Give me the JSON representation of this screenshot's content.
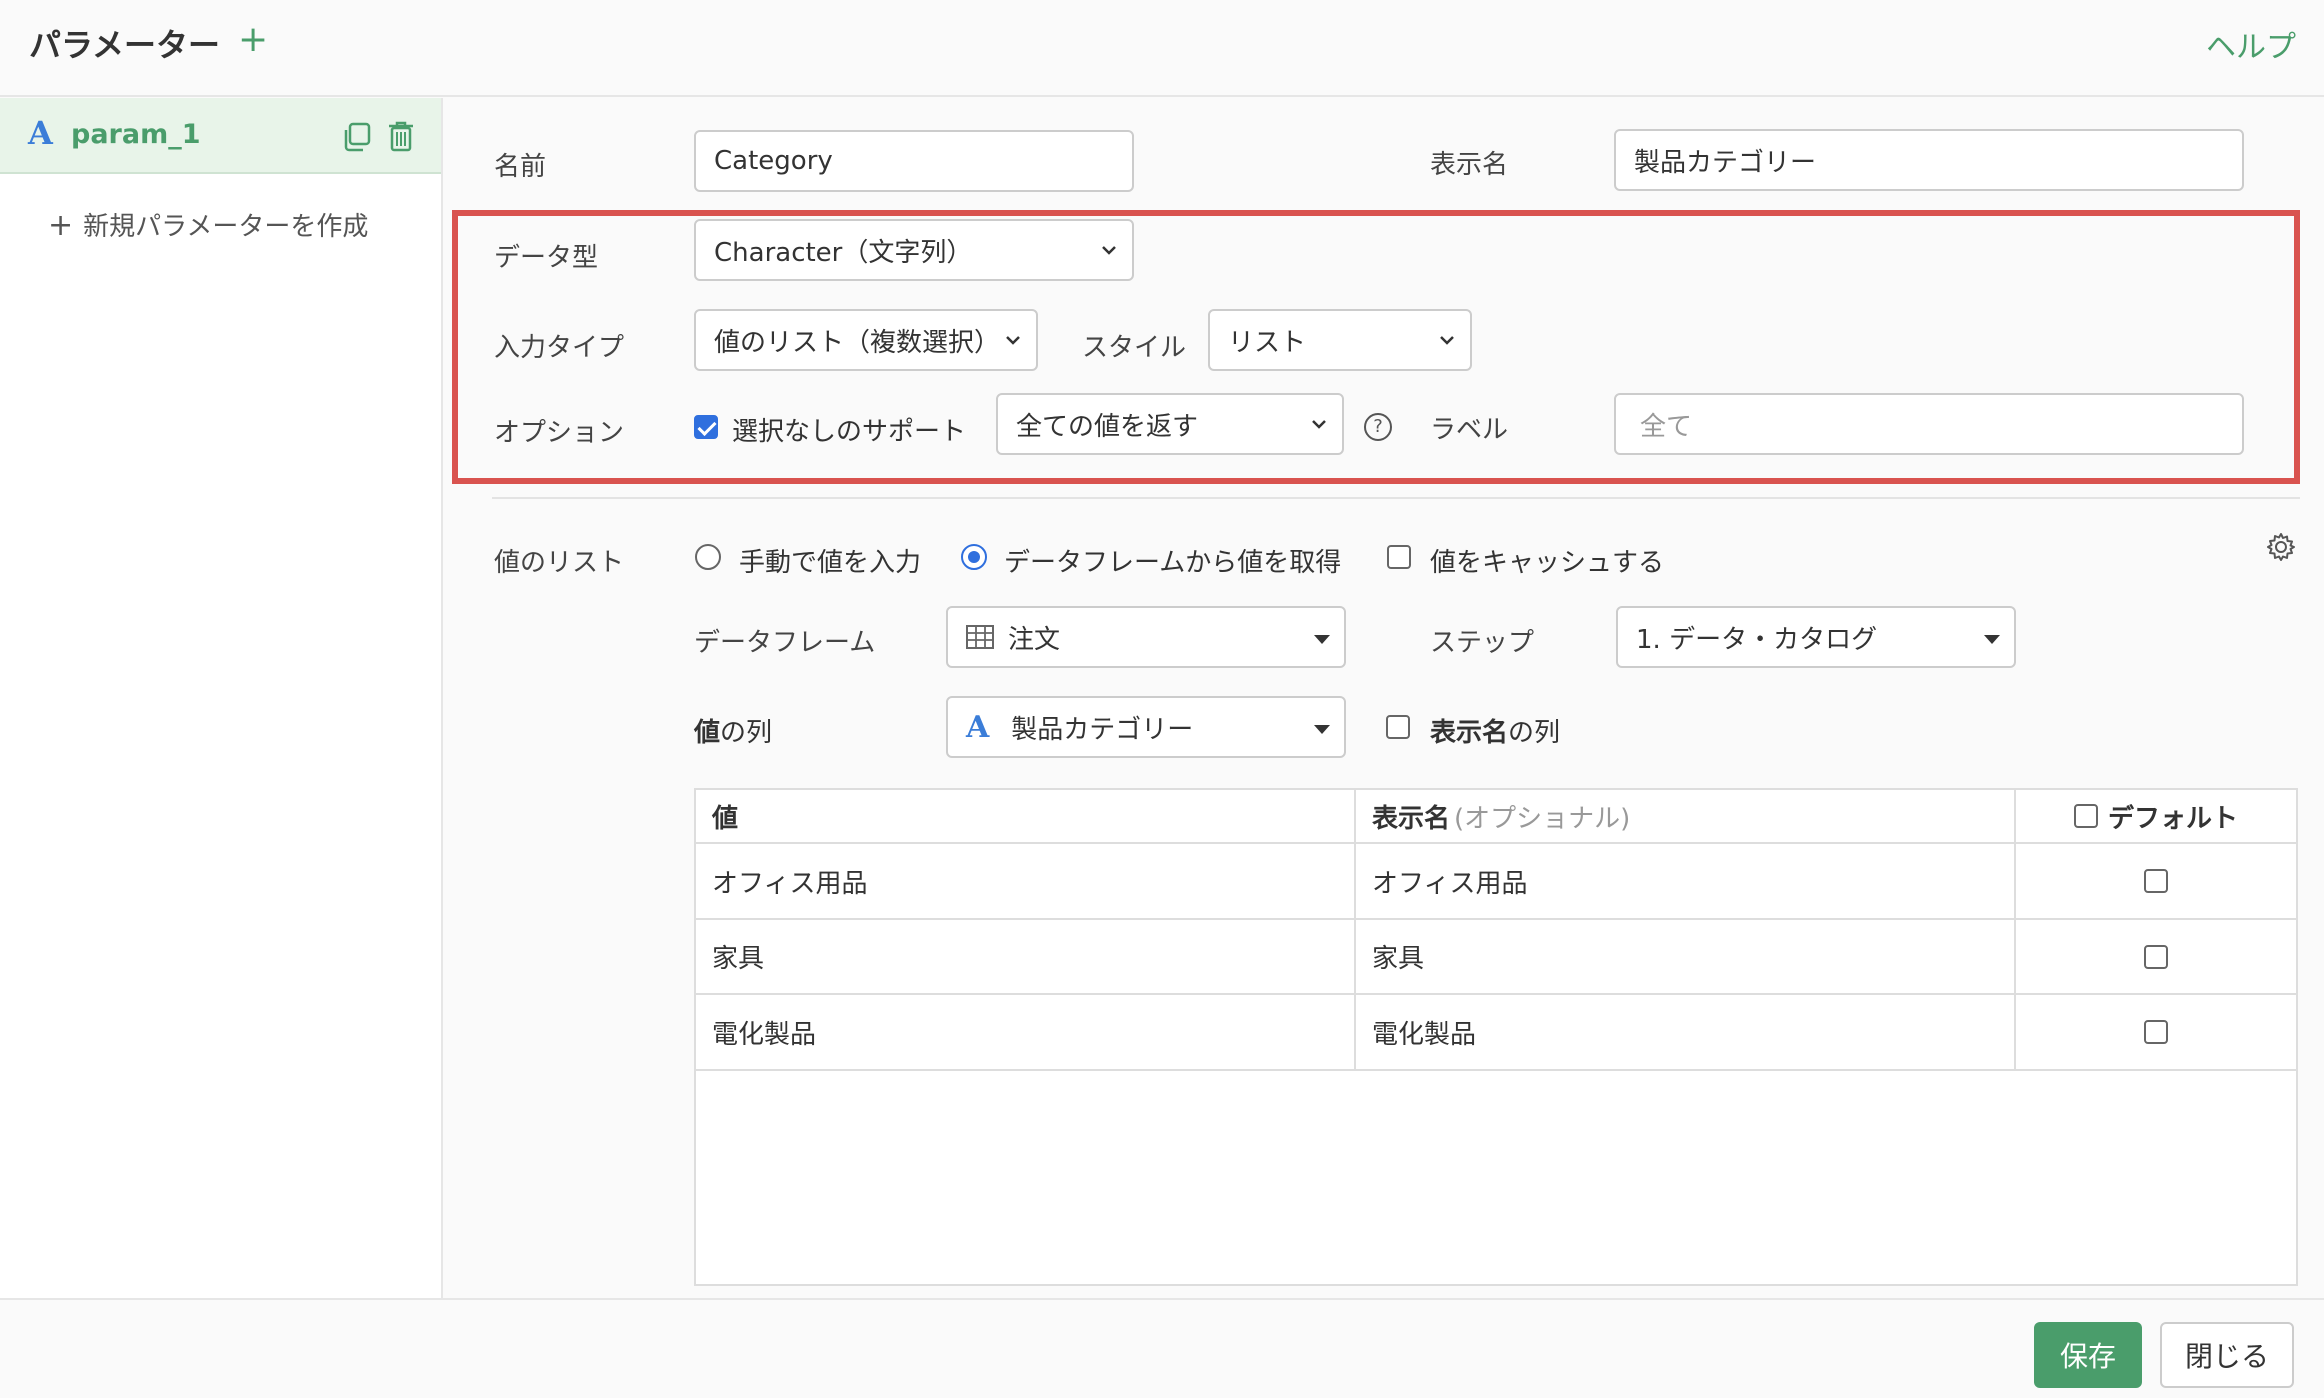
{
  "header": {
    "title": "パラメーター",
    "add_icon": "plus-icon",
    "help": "ヘルプ"
  },
  "sidebar": {
    "param": {
      "type_icon": "A",
      "name": "param_1"
    },
    "new_param": "新規パラメーターを作成"
  },
  "form": {
    "name_label": "名前",
    "name_value": "Category",
    "display_name_label": "表示名",
    "display_name_value": "製品カテゴリー",
    "data_type_label": "データ型",
    "data_type_value": "Character（文字列）",
    "input_type_label": "入力タイプ",
    "input_type_value": "値のリスト（複数選択）",
    "style_label": "スタイル",
    "style_value": "リスト",
    "option_label": "オプション",
    "no_selection_label": "選択なしのサポート",
    "no_selection_checked": true,
    "return_value": "全ての値を返す",
    "help_symbol": "?",
    "label_label": "ラベル",
    "label_value": "全て"
  },
  "values": {
    "section_label": "値のリスト",
    "manual_label": "手動で値を入力",
    "dataframe_radio_label": "データフレームから値を取得",
    "cache_label": "値をキャッシュする",
    "dataframe_label": "データフレーム",
    "dataframe_value": "注文",
    "step_label": "ステップ",
    "step_value": "1. データ・カタログ",
    "value_column_label_bold": "値",
    "value_column_label_rest": "の列",
    "value_column_type": "A",
    "value_column_value": "製品カテゴリー",
    "display_column_label_bold": "表示名",
    "display_column_label_rest": "の列"
  },
  "table": {
    "headers": {
      "value": "値",
      "display": "表示名",
      "display_optional": "(オプショナル)",
      "default": "デフォルト"
    },
    "rows": [
      {
        "value": "オフィス用品",
        "display": "オフィス用品"
      },
      {
        "value": "家具",
        "display": "家具"
      },
      {
        "value": "電化製品",
        "display": "電化製品"
      }
    ]
  },
  "footer": {
    "save": "保存",
    "close": "閉じる"
  },
  "colors": {
    "accent_green": "#4a9d6b",
    "highlight_red": "#d9534f",
    "checkbox_blue": "#2f6fde",
    "type_icon_blue": "#3b7dd8"
  }
}
